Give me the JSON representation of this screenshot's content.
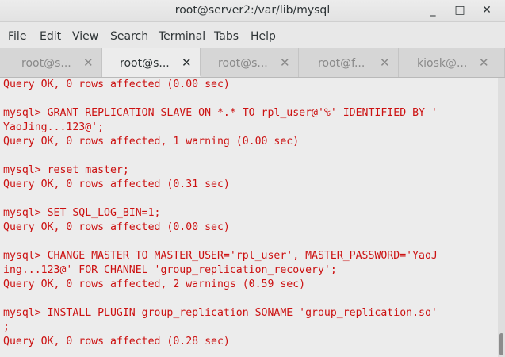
{
  "window": {
    "title": "root@server2:/var/lib/mysql",
    "minimize_glyph": "_",
    "maximize_glyph": "□",
    "close_glyph": "✕"
  },
  "menu": [
    "File",
    "Edit",
    "View",
    "Search",
    "Terminal",
    "Tabs",
    "Help"
  ],
  "tabs": [
    {
      "label": "root@s...",
      "close": "✕",
      "active": false
    },
    {
      "label": "root@s...",
      "close": "✕",
      "active": true
    },
    {
      "label": "root@s...",
      "close": "✕",
      "active": false
    },
    {
      "label": "root@f...",
      "close": "✕",
      "active": false
    },
    {
      "label": "kiosk@...",
      "close": "✕",
      "active": false
    }
  ],
  "terminal": {
    "lines": [
      "Query OK, 0 rows affected (0.00 sec)",
      "",
      "mysql> GRANT REPLICATION SLAVE ON *.* TO rpl_user@'%' IDENTIFIED BY '",
      "YaoJing...123@';",
      "Query OK, 0 rows affected, 1 warning (0.00 sec)",
      "",
      "mysql> reset master;",
      "Query OK, 0 rows affected (0.31 sec)",
      "",
      "mysql> SET SQL_LOG_BIN=1;",
      "Query OK, 0 rows affected (0.00 sec)",
      "",
      "mysql> CHANGE MASTER TO MASTER_USER='rpl_user', MASTER_PASSWORD='YaoJ",
      "ing...123@' FOR CHANNEL 'group_replication_recovery';",
      "Query OK, 0 rows affected, 2 warnings (0.59 sec)",
      "",
      "mysql> INSTALL PLUGIN group_replication SONAME 'group_replication.so'",
      ";",
      "Query OK, 0 rows affected (0.28 sec)"
    ],
    "text_color": "#cc1111",
    "background": "#ececec"
  }
}
